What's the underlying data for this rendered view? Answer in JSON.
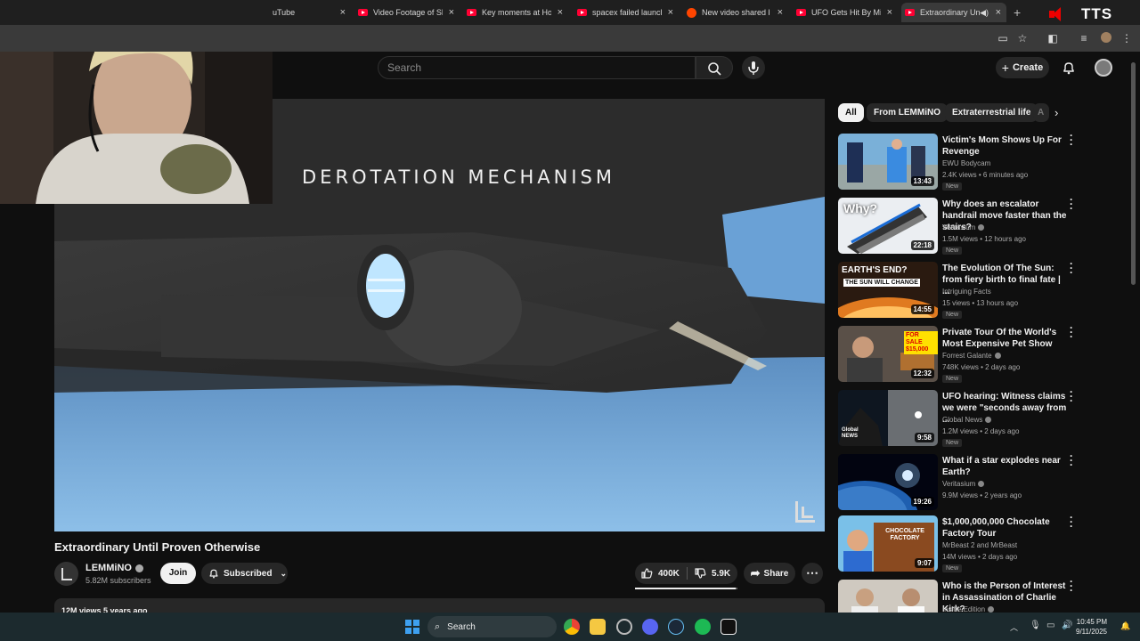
{
  "browser": {
    "tabs": [
      {
        "label": "uTube",
        "icon": "none"
      },
      {
        "label": "Video Footage of Sh",
        "icon": "youtube"
      },
      {
        "label": "Key moments at Hou",
        "icon": "youtube"
      },
      {
        "label": "spacex failed launch",
        "icon": "youtube"
      },
      {
        "label": "New video shared by",
        "icon": "reddit"
      },
      {
        "label": "UFO Gets Hit By Miss",
        "icon": "youtube"
      },
      {
        "label": "Extraordinary Un",
        "icon": "youtube",
        "active": true
      }
    ],
    "close_glyph": "×",
    "new_tab_glyph": "+",
    "tts_label": "TTS"
  },
  "youtube": {
    "search_placeholder": "Search",
    "create_label": "Create",
    "chips": [
      "All",
      "From LEMMiNO",
      "Extraterrestrial life",
      "A"
    ],
    "video_overlay_text": "DEROTATION MECHANISM",
    "video_title": "Extraordinary Until Proven Otherwise",
    "channel": {
      "name": "LEMMiNO",
      "subscribers": "5.82M subscribers"
    },
    "join_label": "Join",
    "subscribed_label": "Subscribed",
    "likes": "400K",
    "dislikes": "5.9K",
    "like_ratio": 0.98,
    "share_label": "Share",
    "more_glyph": "⋯",
    "meta_line": "12M views  5 years ago",
    "recommendations": [
      {
        "title": "Victim's Mom Shows Up For Revenge",
        "channel": "EWU Bodycam",
        "verified": false,
        "views": "2.4K views • 6 minutes ago",
        "badge": "New",
        "duration": "13:43"
      },
      {
        "title": "Why does an escalator handrail move faster than the stairs?",
        "channel": "Veritasium",
        "verified": true,
        "views": "1.5M views • 12 hours ago",
        "badge": "New",
        "duration": "22:18"
      },
      {
        "title": "The Evolution Of The Sun: from fiery birth to final fate | ...",
        "channel": "Intriguing Facts",
        "verified": false,
        "views": "15 views • 13 hours ago",
        "badge": "New",
        "duration": "14:55"
      },
      {
        "title": "Private Tour Of the World's Most Expensive Pet Show",
        "channel": "Forrest Galante",
        "verified": true,
        "views": "748K views • 2 days ago",
        "badge": "New",
        "duration": "12:32"
      },
      {
        "title": "UFO hearing: Witness claims we were \"seconds away from ...",
        "channel": "Global News",
        "verified": true,
        "views": "1.2M views • 2 days ago",
        "badge": "New",
        "duration": "9:58"
      },
      {
        "title": "What if a star explodes near Earth?",
        "channel": "Veritasium",
        "verified": true,
        "views": "9.9M views • 2 years ago",
        "badge": "",
        "duration": "19:26"
      },
      {
        "title": "$1,000,000,000 Chocolate Factory Tour",
        "channel": "MrBeast 2 and MrBeast",
        "verified": false,
        "views": "14M views • 2 days ago",
        "badge": "New",
        "duration": "9:07"
      },
      {
        "title": "Who is the Person of Interest in Assassination of Charlie Kirk?",
        "channel": "Inside Edition",
        "verified": true,
        "views": "",
        "badge": "",
        "duration": ""
      }
    ],
    "thumb_texts": {
      "t1": "Why?",
      "t2a": "EARTH'S END?",
      "t2b": "THE SUN WILL CHANGE",
      "t3": "FOR SALE $15,000",
      "t4": "Global NEWS",
      "t6": "CHOCOLATE FACTORY"
    }
  },
  "taskbar": {
    "search_label": "Search",
    "time": "10:45 PM",
    "date": "9/11/2025"
  }
}
